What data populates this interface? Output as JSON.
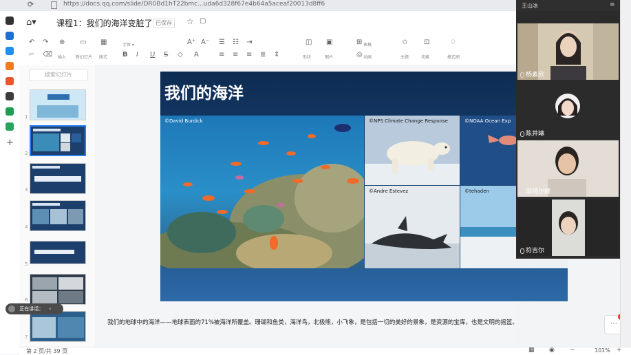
{
  "browser": {
    "url": "https://docs.qq.com/slide/DR0Bd1hT22bmc...uda6d328f67e4b64a5aceaf20013d8ff6"
  },
  "header": {
    "title": "课程1：我们的海洋变脏了",
    "badge": "已保存"
  },
  "toolbar": {
    "groups": [
      {
        "label": "格式刷"
      },
      {
        "label": "插入"
      },
      {
        "label": "新幻灯片"
      },
      {
        "label": "版式"
      },
      {
        "label": "主题"
      },
      {
        "label": "形状"
      },
      {
        "label": "图片"
      },
      {
        "label": "表格"
      },
      {
        "label": "动画"
      },
      {
        "label": "切换"
      }
    ]
  },
  "thumbs": {
    "search_placeholder": "搜索幻灯片",
    "items": [
      {
        "num": "1",
        "selected": false
      },
      {
        "num": "2",
        "selected": true
      },
      {
        "num": "3",
        "selected": false
      },
      {
        "num": "4",
        "selected": false
      },
      {
        "num": "5",
        "selected": false
      },
      {
        "num": "6",
        "selected": false
      },
      {
        "num": "7",
        "selected": false
      }
    ]
  },
  "slide": {
    "title": "我们的海洋",
    "credits": {
      "reef": "©David Burdick",
      "bear": "©NPS Climate Change Response",
      "noaa": "©NOAA Ocean Exp",
      "whale": "©Andre Estevez",
      "beach": "©tehaden"
    }
  },
  "notes": "我们的地球中的海洋——地球表面的71%被海洋所覆盖。珊瑚和鱼类，海洋鸟，北极熊，小飞象，是包括一切的美好的景象，是资源的宝库，也是文明的摇篮。",
  "status": {
    "page": "第 2 页/共 39 页",
    "zoom": "101%"
  },
  "chat": {
    "badge": "1"
  },
  "speaker": {
    "label": "正在讲话："
  },
  "video": {
    "host": "王山冰",
    "tiles": [
      {
        "name": "杨素欣"
      },
      {
        "name": "陈井琳"
      },
      {
        "name": "琪琦尔娜"
      },
      {
        "name": "符吉尔"
      }
    ]
  },
  "colors": {
    "accent": "#2a7df0",
    "slide_bg": "#1c4a7e",
    "video_bg": "#2b2b2b"
  }
}
